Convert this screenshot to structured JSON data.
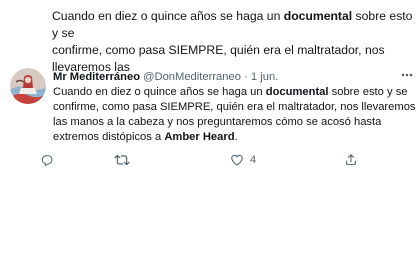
{
  "top_partial": {
    "line1_pre": "Cuando en diez o quince años se haga un ",
    "line1_bold": "documental",
    "line1_post": " sobre esto y se",
    "line2": "confirme, como pasa SIEMPRE, quién era el maltratador, nos llevaremos las"
  },
  "tweet": {
    "display_name": "Mr Mediterráneo",
    "handle": "@DonMediterraneo",
    "separator": "·",
    "timestamp": "1 jun.",
    "text_pre": "Cuando en diez o quince años se haga un ",
    "text_bold1": "documental",
    "text_mid": " sobre esto y se confirme, como pasa SIEMPRE, quién era el maltratador, nos llevaremos las manos a la cabeza y nos preguntaremos cómo se acosó hasta extremos distópicos a ",
    "text_bold2": "Amber Heard",
    "text_end": ".",
    "actions": {
      "reply_count": "",
      "retweet_count": "",
      "like_count": "4"
    }
  },
  "icons": {
    "avatar": "avatar-image",
    "more": "more-icon",
    "reply": "reply-icon",
    "retweet": "retweet-icon",
    "like": "like-icon",
    "share": "share-icon"
  },
  "colors": {
    "text_primary": "#0f1419",
    "text_secondary": "#536471",
    "background": "#ffffff"
  }
}
